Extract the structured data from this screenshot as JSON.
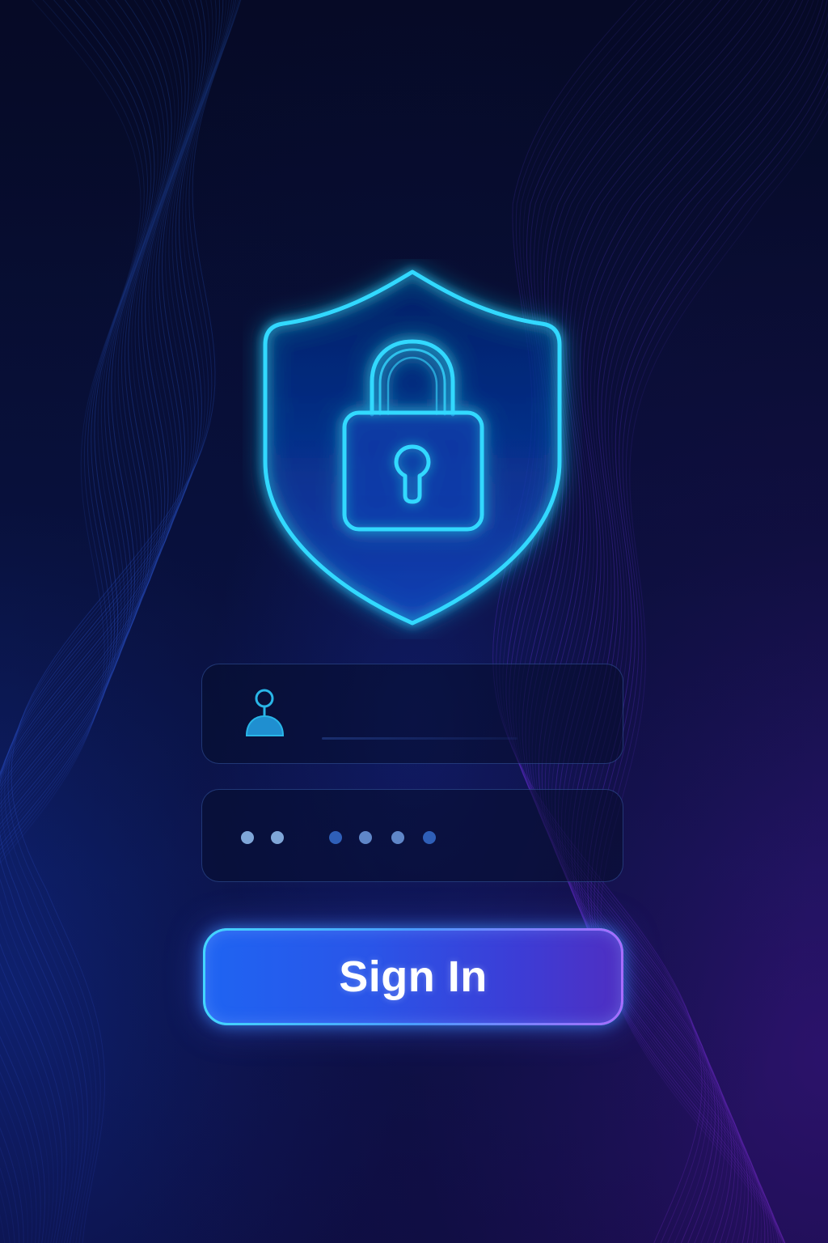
{
  "login": {
    "sign_in_label": "Sign In",
    "username_value": "",
    "password_mask_dot_count": 6
  },
  "icons": {
    "emblem": "shield-lock-icon",
    "username": "user-icon"
  },
  "colors": {
    "neon_cyan": "#33d9ff",
    "button_start": "#1f64f2",
    "button_end": "#4f2fc2",
    "background": "#070b2a",
    "field_border": "#46 6ec8",
    "dot_light": "#7fa6d8",
    "dot_dark": "#2f5fb8"
  }
}
